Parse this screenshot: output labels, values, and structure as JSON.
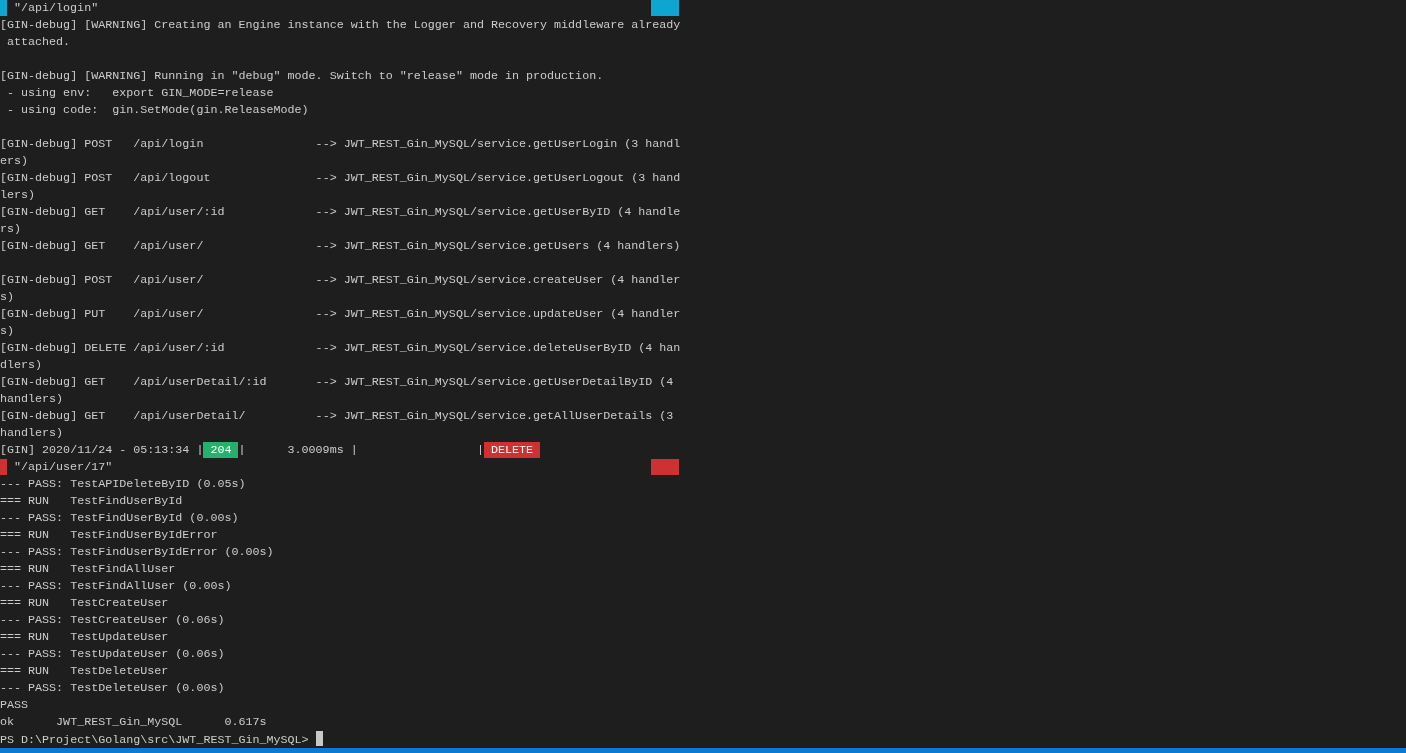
{
  "terminal": {
    "lines": [
      {
        "kind": "path",
        "text": "\"/api/login\"",
        "color": "#0ea5d0"
      },
      {
        "kind": "text",
        "text": "[GIN-debug] [WARNING] Creating an Engine instance with the Logger and Recovery middleware already"
      },
      {
        "kind": "text",
        "text": " attached."
      },
      {
        "kind": "blank"
      },
      {
        "kind": "text",
        "text": "[GIN-debug] [WARNING] Running in \"debug\" mode. Switch to \"release\" mode in production."
      },
      {
        "kind": "text",
        "text": " - using env:   export GIN_MODE=release"
      },
      {
        "kind": "text",
        "text": " - using code:  gin.SetMode(gin.ReleaseMode)"
      },
      {
        "kind": "blank"
      },
      {
        "kind": "text",
        "text": "[GIN-debug] POST   /api/login                --> JWT_REST_Gin_MySQL/service.getUserLogin (3 handl"
      },
      {
        "kind": "text",
        "text": "ers)"
      },
      {
        "kind": "text",
        "text": "[GIN-debug] POST   /api/logout               --> JWT_REST_Gin_MySQL/service.getUserLogout (3 hand"
      },
      {
        "kind": "text",
        "text": "lers)"
      },
      {
        "kind": "text",
        "text": "[GIN-debug] GET    /api/user/:id             --> JWT_REST_Gin_MySQL/service.getUserByID (4 handle"
      },
      {
        "kind": "text",
        "text": "rs)"
      },
      {
        "kind": "text",
        "text": "[GIN-debug] GET    /api/user/                --> JWT_REST_Gin_MySQL/service.getUsers (4 handlers)"
      },
      {
        "kind": "blank"
      },
      {
        "kind": "text",
        "text": "[GIN-debug] POST   /api/user/                --> JWT_REST_Gin_MySQL/service.createUser (4 handler"
      },
      {
        "kind": "text",
        "text": "s)"
      },
      {
        "kind": "text",
        "text": "[GIN-debug] PUT    /api/user/                --> JWT_REST_Gin_MySQL/service.updateUser (4 handler"
      },
      {
        "kind": "text",
        "text": "s)"
      },
      {
        "kind": "text",
        "text": "[GIN-debug] DELETE /api/user/:id             --> JWT_REST_Gin_MySQL/service.deleteUserByID (4 han"
      },
      {
        "kind": "text",
        "text": "dlers)"
      },
      {
        "kind": "text",
        "text": "[GIN-debug] GET    /api/userDetail/:id       --> JWT_REST_Gin_MySQL/service.getUserDetailByID (4"
      },
      {
        "kind": "text",
        "text": "handlers)"
      },
      {
        "kind": "text",
        "text": "[GIN-debug] GET    /api/userDetail/          --> JWT_REST_Gin_MySQL/service.getAllUserDetails (3"
      },
      {
        "kind": "text",
        "text": "handlers)"
      },
      {
        "kind": "log",
        "parts": [
          {
            "kind": "text",
            "text": "[GIN] 2020/11/24 - 05:13:34 |"
          },
          {
            "kind": "badge",
            "text": "204",
            "color": "#22b26d"
          },
          {
            "kind": "text",
            "text": "|      3.0009ms |                 |"
          },
          {
            "kind": "badge",
            "text": "DELETE",
            "color": "#cd3131"
          }
        ]
      },
      {
        "kind": "path",
        "text": "\"/api/user/17\"",
        "color": "#cd3131"
      },
      {
        "kind": "text",
        "text": "--- PASS: TestAPIDeleteByID (0.05s)"
      },
      {
        "kind": "text",
        "text": "=== RUN   TestFindUserById"
      },
      {
        "kind": "text",
        "text": "--- PASS: TestFindUserById (0.00s)"
      },
      {
        "kind": "text",
        "text": "=== RUN   TestFindUserByIdError"
      },
      {
        "kind": "text",
        "text": "--- PASS: TestFindUserByIdError (0.00s)"
      },
      {
        "kind": "text",
        "text": "=== RUN   TestFindAllUser"
      },
      {
        "kind": "text",
        "text": "--- PASS: TestFindAllUser (0.00s)"
      },
      {
        "kind": "text",
        "text": "=== RUN   TestCreateUser"
      },
      {
        "kind": "text",
        "text": "--- PASS: TestCreateUser (0.06s)"
      },
      {
        "kind": "text",
        "text": "=== RUN   TestUpdateUser"
      },
      {
        "kind": "text",
        "text": "--- PASS: TestUpdateUser (0.06s)"
      },
      {
        "kind": "text",
        "text": "=== RUN   TestDeleteUser"
      },
      {
        "kind": "text",
        "text": "--- PASS: TestDeleteUser (0.00s)"
      },
      {
        "kind": "text",
        "text": "PASS"
      },
      {
        "kind": "text",
        "text": "ok      JWT_REST_Gin_MySQL      0.617s"
      },
      {
        "kind": "prompt",
        "text": "PS D:\\Project\\Golang\\src\\JWT_REST_Gin_MySQL> "
      }
    ]
  }
}
